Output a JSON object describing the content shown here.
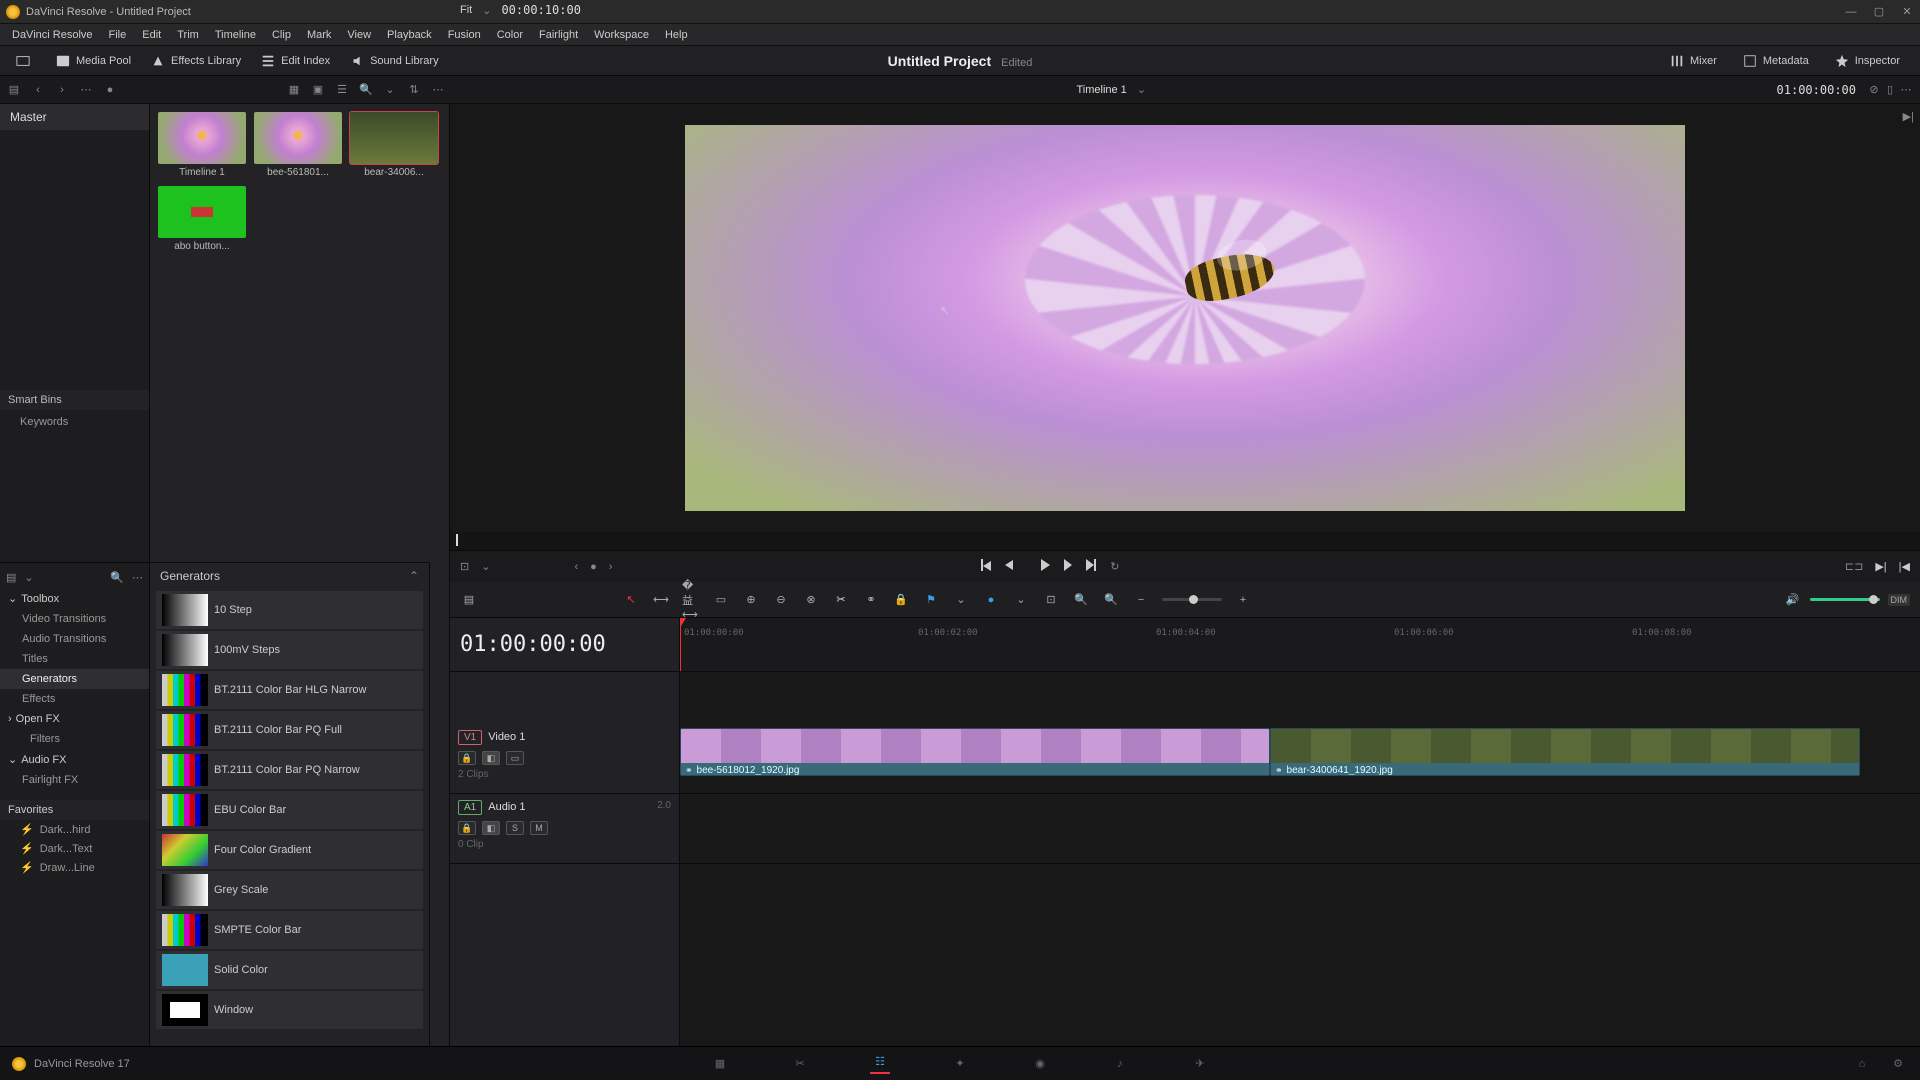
{
  "window": {
    "title": "DaVinci Resolve - Untitled Project"
  },
  "menus": [
    "DaVinci Resolve",
    "File",
    "Edit",
    "Trim",
    "Timeline",
    "Clip",
    "Mark",
    "View",
    "Playback",
    "Fusion",
    "Color",
    "Fairlight",
    "Workspace",
    "Help"
  ],
  "toolbar": {
    "media_pool": "Media Pool",
    "effects_library": "Effects Library",
    "edit_index": "Edit Index",
    "sound_library": "Sound Library",
    "mixer": "Mixer",
    "metadata": "Metadata",
    "inspector": "Inspector"
  },
  "project": {
    "name": "Untitled Project",
    "status": "Edited"
  },
  "source": {
    "fit": "Fit",
    "tc": "00:00:10:00"
  },
  "timeline": {
    "name": "Timeline 1",
    "tc": "01:00:00:00"
  },
  "bins": {
    "master": "Master",
    "smart": "Smart Bins",
    "keywords": "Keywords"
  },
  "clips": [
    {
      "name": "Timeline 1",
      "kind": "timeline"
    },
    {
      "name": "bee-561801...",
      "kind": "flower"
    },
    {
      "name": "bear-34006...",
      "kind": "bear",
      "selected": true
    },
    {
      "name": "abo button...",
      "kind": "green"
    }
  ],
  "toolbox": {
    "header": "Toolbox",
    "items": [
      "Video Transitions",
      "Audio Transitions",
      "Titles",
      "Generators",
      "Effects"
    ],
    "active": "Generators",
    "openfx": "Open FX",
    "filters": "Filters",
    "audiofx": "Audio FX",
    "fairlightfx": "Fairlight FX",
    "favorites": "Favorites",
    "fav_items": [
      "Dark...hird",
      "Dark...Text",
      "Draw...Line"
    ]
  },
  "generators": {
    "header": "Generators",
    "items": [
      {
        "name": "10 Step",
        "sw": "gray"
      },
      {
        "name": "100mV Steps",
        "sw": "gray"
      },
      {
        "name": "BT.2111 Color Bar HLG Narrow",
        "sw": "bars"
      },
      {
        "name": "BT.2111 Color Bar PQ Full",
        "sw": "bars"
      },
      {
        "name": "BT.2111 Color Bar PQ Narrow",
        "sw": "bars"
      },
      {
        "name": "EBU Color Bar",
        "sw": "bars"
      },
      {
        "name": "Four Color Gradient",
        "sw": "grad4"
      },
      {
        "name": "Grey Scale",
        "sw": "gray"
      },
      {
        "name": "SMPTE Color Bar",
        "sw": "bars"
      },
      {
        "name": "Solid Color",
        "sw": "solid"
      },
      {
        "name": "Window",
        "sw": "win"
      }
    ]
  },
  "tracks": {
    "big_tc": "01:00:00:00",
    "video": {
      "badge": "V1",
      "name": "Video 1",
      "clips": "2 Clips"
    },
    "audio": {
      "badge": "A1",
      "name": "Audio 1",
      "meter": "2.0",
      "clips": "0 Clip",
      "solo": "S",
      "mute": "M"
    },
    "clip1": "bee-5618012_1920.jpg",
    "clip2": "bear-3400641_1920.jpg"
  },
  "ruler_labels": [
    "01:00:00:00",
    "01:00:02:00",
    "01:00:04:00",
    "01:00:06:00",
    "01:00:08:00"
  ],
  "dim": "DIM",
  "app_version": "DaVinci Resolve 17"
}
